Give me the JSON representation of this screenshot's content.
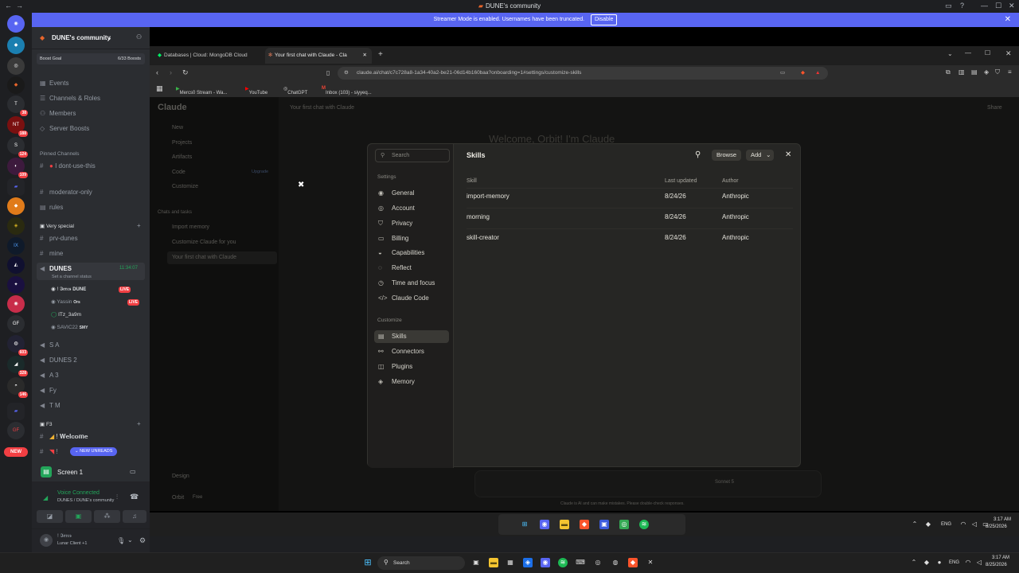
{
  "titlebar": {
    "title": "DUNE's community"
  },
  "banner": {
    "text": "Streamer Mode is enabled. Usernames have been truncated.",
    "disable_label": "Disable"
  },
  "rail": {
    "badges": [
      "38",
      "188",
      "124",
      "109",
      "603",
      "328",
      "146"
    ],
    "new_label": "NEW"
  },
  "server": {
    "name": "DUNE's community",
    "boost": {
      "goal_label": "Boost Goal",
      "count": "6/33 Boosts"
    },
    "menu": [
      "Events",
      "Channels & Roles",
      "Members",
      "Server Boosts"
    ],
    "pinned_header": "Pinned Channels",
    "pinned": [
      "I dont-use-this"
    ],
    "channels": [
      "moderator-only",
      "rules"
    ],
    "category_special": "Very special",
    "special_channels": [
      "prv-dunes",
      "mine"
    ],
    "voice": {
      "name": "DUNES",
      "time": "11:34:07",
      "status": "Set a channel status",
      "users": [
        {
          "name": "! 𝕴𝖊𝖗𝖈𝖘",
          "tag": "DUNE",
          "live": "LIVE"
        },
        {
          "name": "Yassin",
          "tag": "Ors",
          "live": "LIVE"
        },
        {
          "name": "ITz_3a9m",
          "tag": "",
          "live": ""
        },
        {
          "name": "SAVIC22",
          "tag": "SMY",
          "live": ""
        }
      ]
    },
    "other_voice": [
      "S A",
      "DUNES 2",
      "A 3",
      "Fy",
      "T M"
    ],
    "category_f3": "F3",
    "f3_channels": [
      "! 𝐖𝐞𝐥𝐜𝐨𝐦𝐞",
      "! "
    ],
    "new_unreads": "NEW UNREADS"
  },
  "voice_panel": {
    "screen_label": "Screen 1",
    "connected": "Voice Connected",
    "location": "DUNES / DUNE's community",
    "user_name": "! 𝕴𝖊𝖗𝖈𝖘",
    "user_status": "Lunar Client +1"
  },
  "browser": {
    "tabs": [
      "Databases | Cloud: MongoDB Cloud",
      "Your first chat with Claude - Cla"
    ],
    "url": "claude.ai/chat/c7c728a8-1a34-40a2-be21-06d14b160baa?onboarding=1#settings/customize-skills",
    "bookmarks": [
      "Mercs0 Stream - Wa...",
      "YouTube",
      "ChatGPT",
      "Inbox (103) - siyyeq..."
    ]
  },
  "claude_bg": {
    "brand": "Claude",
    "chat_title": "Your first chat with Claude",
    "welcome": "Welcome, Orbit! I'm Claude",
    "nav": [
      "New",
      "Projects",
      "Artifacts",
      "Code",
      "Customize"
    ],
    "recents_label": "Chats and tasks",
    "recents": [
      "Import memory",
      "Customize Claude for you",
      "Your first chat with Claude"
    ],
    "share": "Share",
    "model": "Sonnet 5",
    "footer_user": "Orbit",
    "footer_plan": "Free",
    "design": "Design",
    "upgrade": "Upgrade",
    "disclaimer": "Claude is AI and can make mistakes. Please double-check responses."
  },
  "modal": {
    "search_placeholder": "Search",
    "settings_header": "Settings",
    "settings_items": [
      "General",
      "Account",
      "Privacy",
      "Billing",
      "Capabilities",
      "Reflect",
      "Time and focus",
      "Claude Code"
    ],
    "customize_header": "Customize",
    "customize_items": [
      "Skills",
      "Connectors",
      "Plugins",
      "Memory"
    ],
    "title": "Skills",
    "browse": "Browse",
    "add": "Add",
    "columns": {
      "skill": "Skill",
      "updated": "Last updated",
      "author": "Author"
    },
    "rows": [
      {
        "skill": "import-memory",
        "updated": "8/24/26",
        "author": "Anthropic"
      },
      {
        "skill": "morning",
        "updated": "8/24/26",
        "author": "Anthropic"
      },
      {
        "skill": "skill-creator",
        "updated": "8/24/26",
        "author": "Anthropic"
      }
    ]
  },
  "inner_taskbar": {
    "lang": "ENG",
    "time": "3:17 AM",
    "date": "8/25/2026"
  },
  "win_taskbar": {
    "search": "Search",
    "lang": "ENG",
    "time": "3:17 AM",
    "date": "8/25/2026"
  }
}
